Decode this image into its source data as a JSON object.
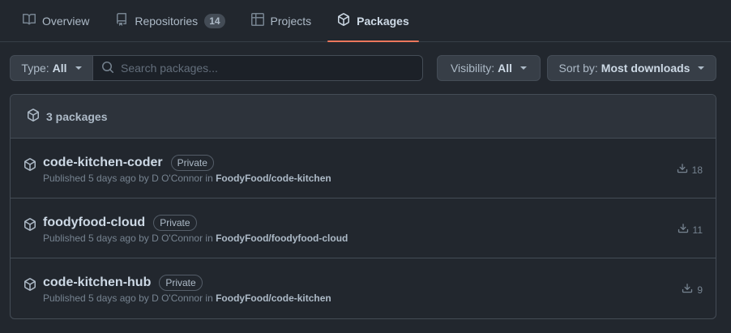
{
  "tabs": [
    {
      "label": "Overview",
      "icon": "book-icon",
      "selected": false
    },
    {
      "label": "Repositories",
      "icon": "repo-icon",
      "count": "14",
      "selected": false
    },
    {
      "label": "Projects",
      "icon": "table-icon",
      "selected": false
    },
    {
      "label": "Packages",
      "icon": "package-icon",
      "selected": true
    }
  ],
  "filters": {
    "type_label": "Type:",
    "type_value": "All",
    "search_placeholder": "Search packages...",
    "visibility_label": "Visibility:",
    "visibility_value": "All",
    "sort_label": "Sort by:",
    "sort_value": "Most downloads"
  },
  "list": {
    "header": "3 packages",
    "packages": [
      {
        "name": "code-kitchen-coder",
        "visibility": "Private",
        "meta_prefix": "Published 5 days ago by D O'Connor in",
        "repo": "FoodyFood/code-kitchen",
        "downloads": "18"
      },
      {
        "name": "foodyfood-cloud",
        "visibility": "Private",
        "meta_prefix": "Published 5 days ago by D O'Connor in",
        "repo": "FoodyFood/foodyfood-cloud",
        "downloads": "11"
      },
      {
        "name": "code-kitchen-hub",
        "visibility": "Private",
        "meta_prefix": "Published 5 days ago by D O'Connor in",
        "repo": "FoodyFood/code-kitchen",
        "downloads": "9"
      }
    ]
  },
  "colors": {
    "background": "#22272e",
    "selected_underline": "#ec775c",
    "border": "#444c56"
  }
}
